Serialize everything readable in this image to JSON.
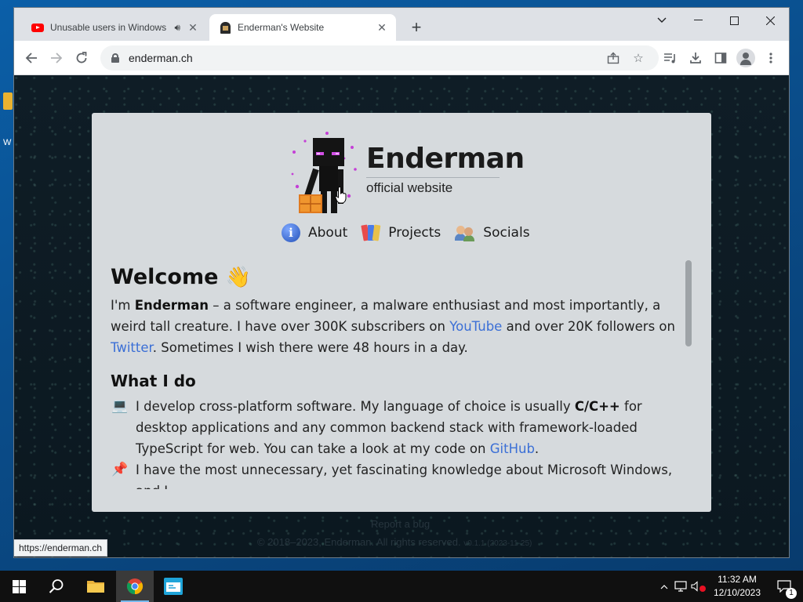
{
  "browser": {
    "tabs": [
      {
        "title": "Unusable users in Windows",
        "active": false,
        "audio": true
      },
      {
        "title": "Enderman's Website",
        "active": true,
        "audio": false
      }
    ],
    "url": "enderman.ch",
    "status_url": "https://enderman.ch"
  },
  "site": {
    "title": "Enderman",
    "subtitle": "official website",
    "nav": [
      {
        "label": "About",
        "icon": "info-icon"
      },
      {
        "label": "Projects",
        "icon": "books-icon"
      },
      {
        "label": "Socials",
        "icon": "people-icon"
      }
    ],
    "welcome": {
      "heading": "Welcome",
      "emoji": "👋",
      "p1_a": "I'm ",
      "p1_name": "Enderman",
      "p1_b": " – a software engineer, a malware enthusiast and most importantly, a weird tall creature. I have over 300K subscribers on ",
      "p1_link1": "YouTube",
      "p1_c": " and over 20K followers on ",
      "p1_link2": "Twitter",
      "p1_d": ". Sometimes I wish there were 48 hours in a day."
    },
    "what": {
      "heading": "What I do",
      "items": [
        {
          "icon": "💻",
          "a": "I develop cross-platform software. My language of choice is usually ",
          "bold": "C/C++",
          "b": " for desktop applications and any common backend stack with framework-loaded TypeScript for web. You can take a look at my code on ",
          "link": "GitHub",
          "c": "."
        },
        {
          "icon": "📌",
          "a": "I have the most unnecessary, yet fascinating knowledge about Microsoft Windows, and I"
        }
      ]
    },
    "footer": {
      "report": "Report a bug",
      "copyright": "© 2018–2023, ",
      "copyright_name": "Enderman",
      "copyright_tail": ". All rights reserved.",
      "version": "v0.1.1 (2023-11-25)"
    }
  },
  "taskbar": {
    "time": "11:32 AM",
    "date": "12/10/2023",
    "notifications": "1"
  },
  "desktop": {
    "icon_label": "W"
  }
}
